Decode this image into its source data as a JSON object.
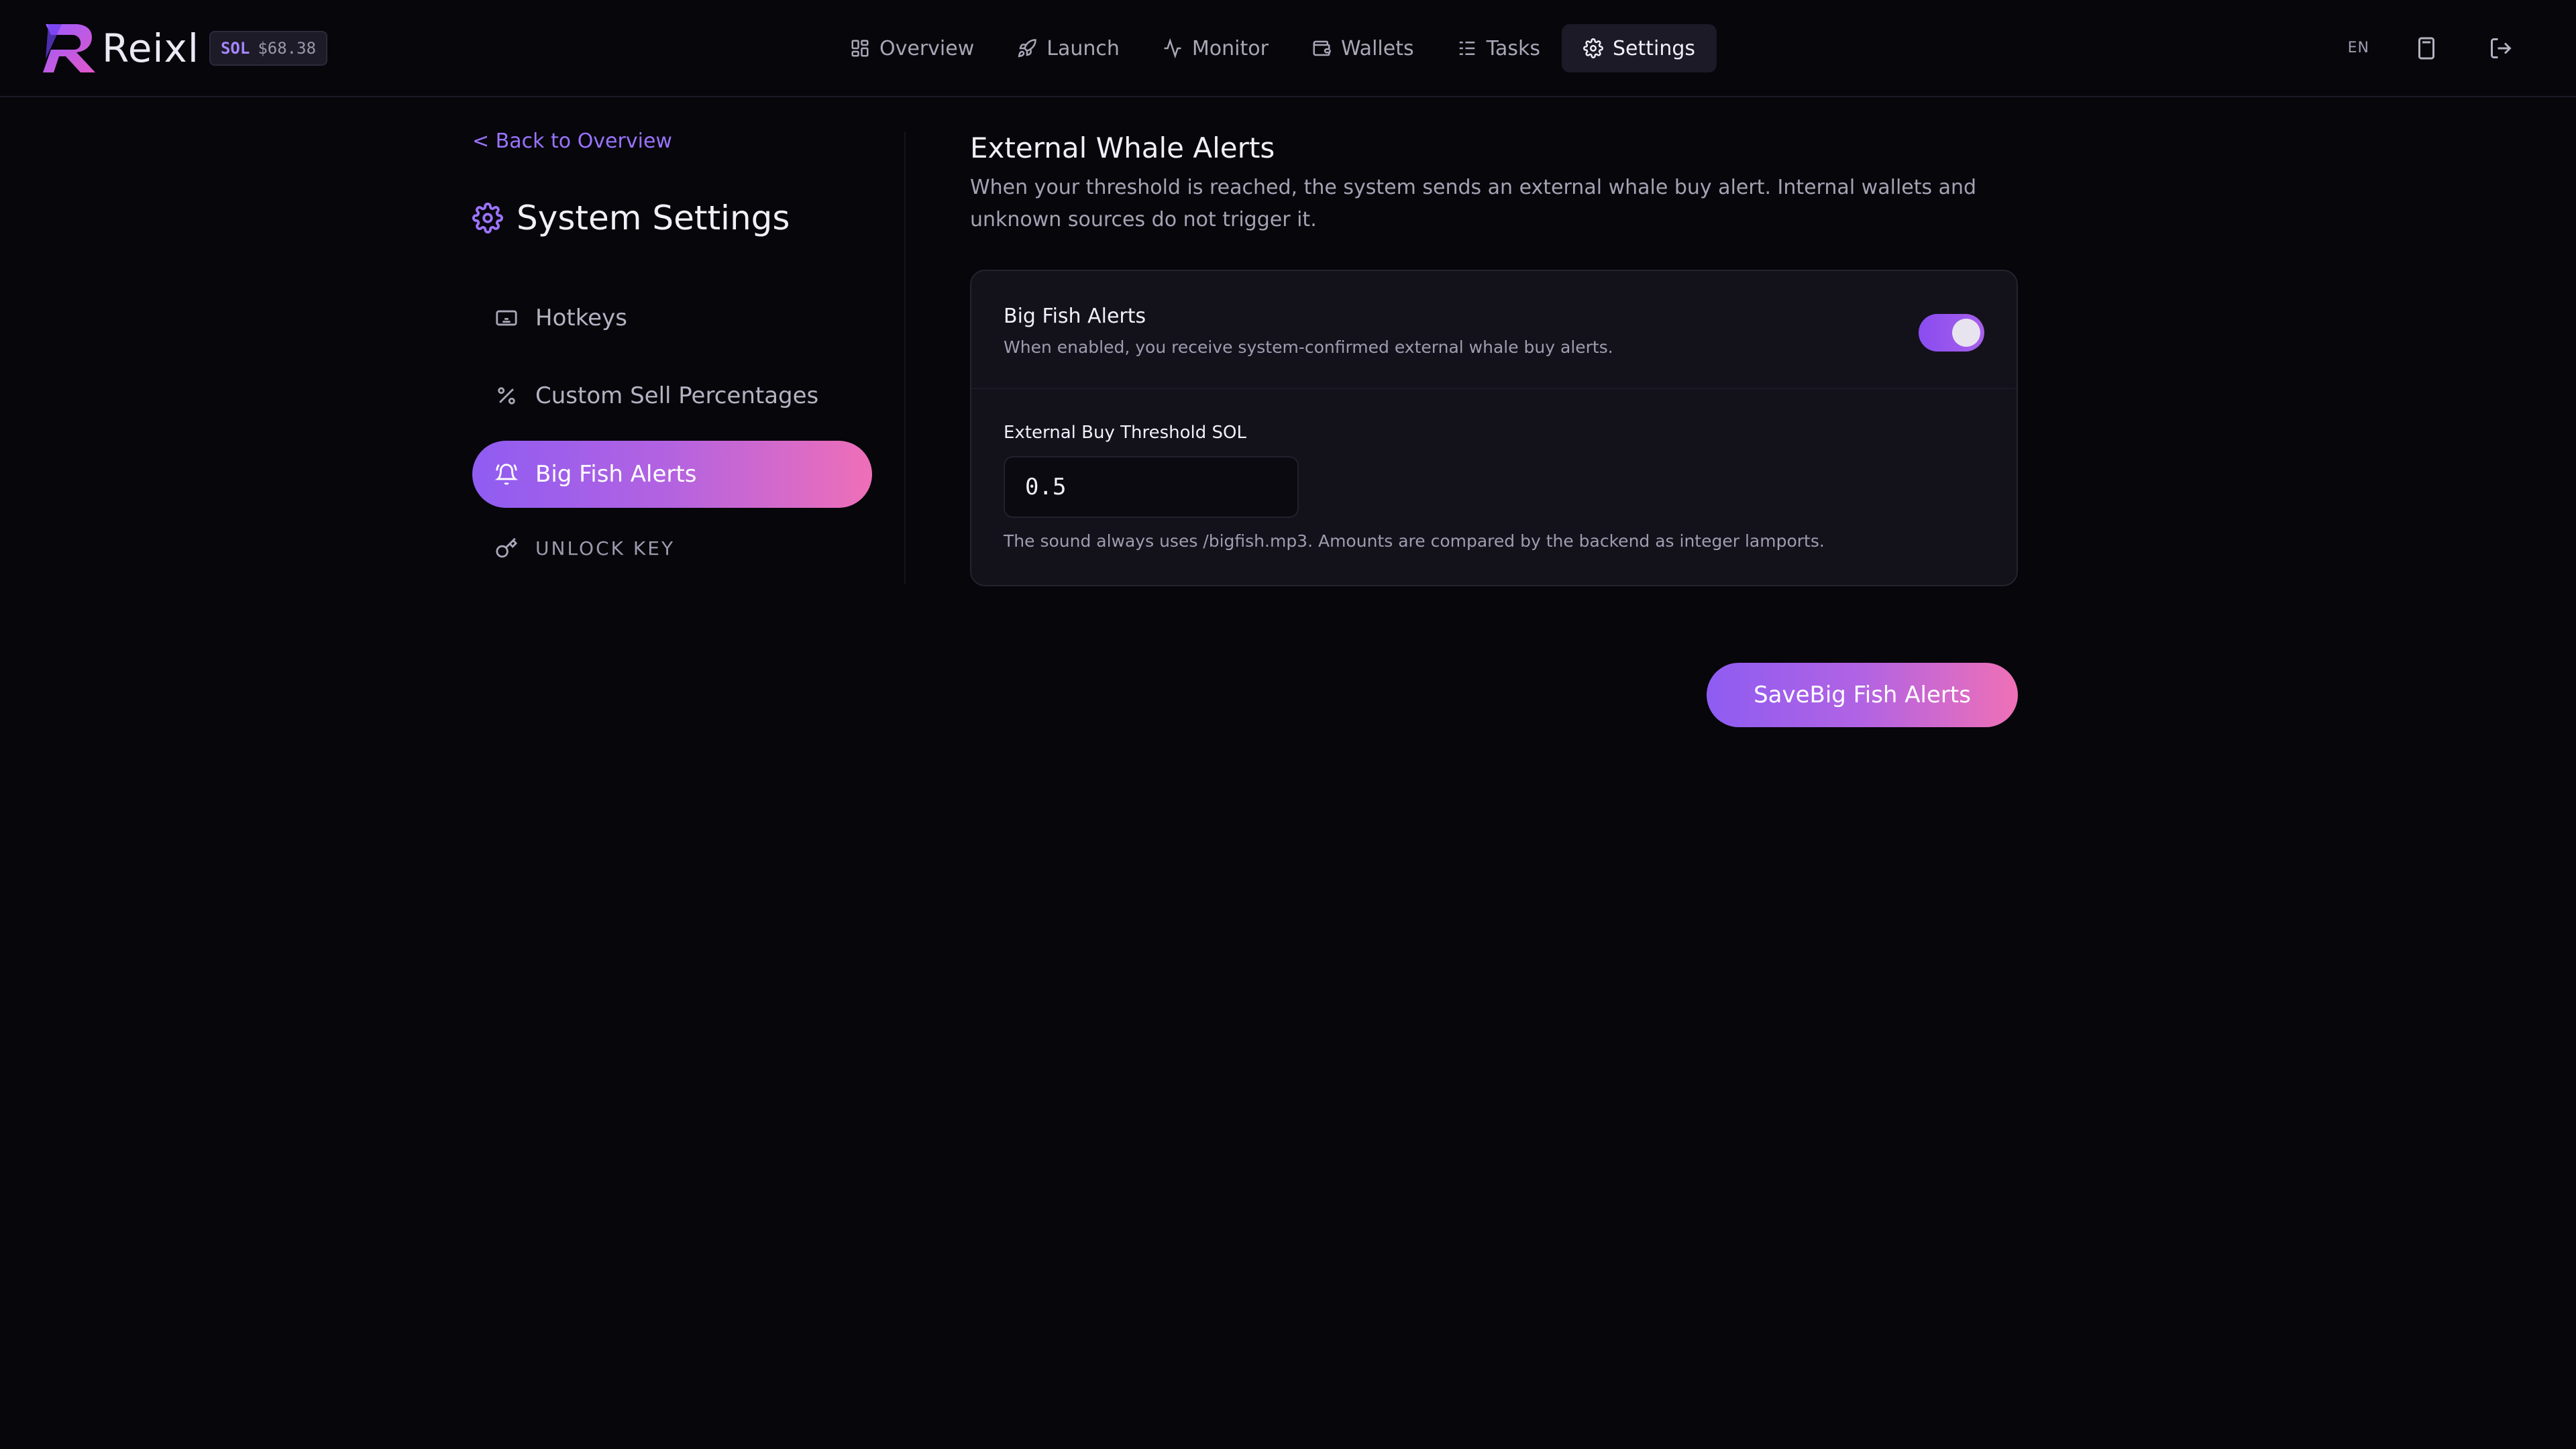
{
  "brand": {
    "name": "Reixl"
  },
  "price_badge": {
    "symbol": "SOL",
    "price": "$68.38"
  },
  "nav": [
    {
      "label": "Overview",
      "icon": "grid-icon",
      "active": false
    },
    {
      "label": "Launch",
      "icon": "rocket-icon",
      "active": false
    },
    {
      "label": "Monitor",
      "icon": "pulse-icon",
      "active": false
    },
    {
      "label": "Wallets",
      "icon": "wallet-icon",
      "active": false
    },
    {
      "label": "Tasks",
      "icon": "list-check-icon",
      "active": false
    },
    {
      "label": "Settings",
      "icon": "gear-icon",
      "active": true
    }
  ],
  "top_right": {
    "language": "EN",
    "icons": [
      "calculator-icon",
      "logout-icon"
    ]
  },
  "sidebar": {
    "back_link": "< Back to Overview",
    "title": "System Settings",
    "items": [
      {
        "label": "Hotkeys",
        "icon": "keyboard-icon",
        "active": false
      },
      {
        "label": "Custom Sell Percentages",
        "icon": "percent-icon",
        "active": false
      },
      {
        "label": "Big Fish Alerts",
        "icon": "bell-icon",
        "active": true
      },
      {
        "label": "UNLOCK KEY",
        "icon": "key-icon",
        "active": false
      }
    ]
  },
  "main": {
    "title": "External Whale Alerts",
    "description": "When your threshold is reached, the system sends an external whale buy alert. Internal wallets and unknown sources do not trigger it.",
    "alert_toggle": {
      "label": "Big Fish Alerts",
      "hint": "When enabled, you receive system-confirmed external whale buy alerts.",
      "enabled": true
    },
    "threshold": {
      "label": "External Buy Threshold SOL",
      "value": "0.5",
      "hint": "The sound always uses /bigfish.mp3. Amounts are compared by the backend as integer lamports."
    },
    "save_label": "SaveBig Fish Alerts"
  },
  "colors": {
    "background": "#07060b",
    "accent_purple": "#8f5cf2",
    "accent_pink": "#ef6fb8",
    "link": "#9a73ff"
  }
}
